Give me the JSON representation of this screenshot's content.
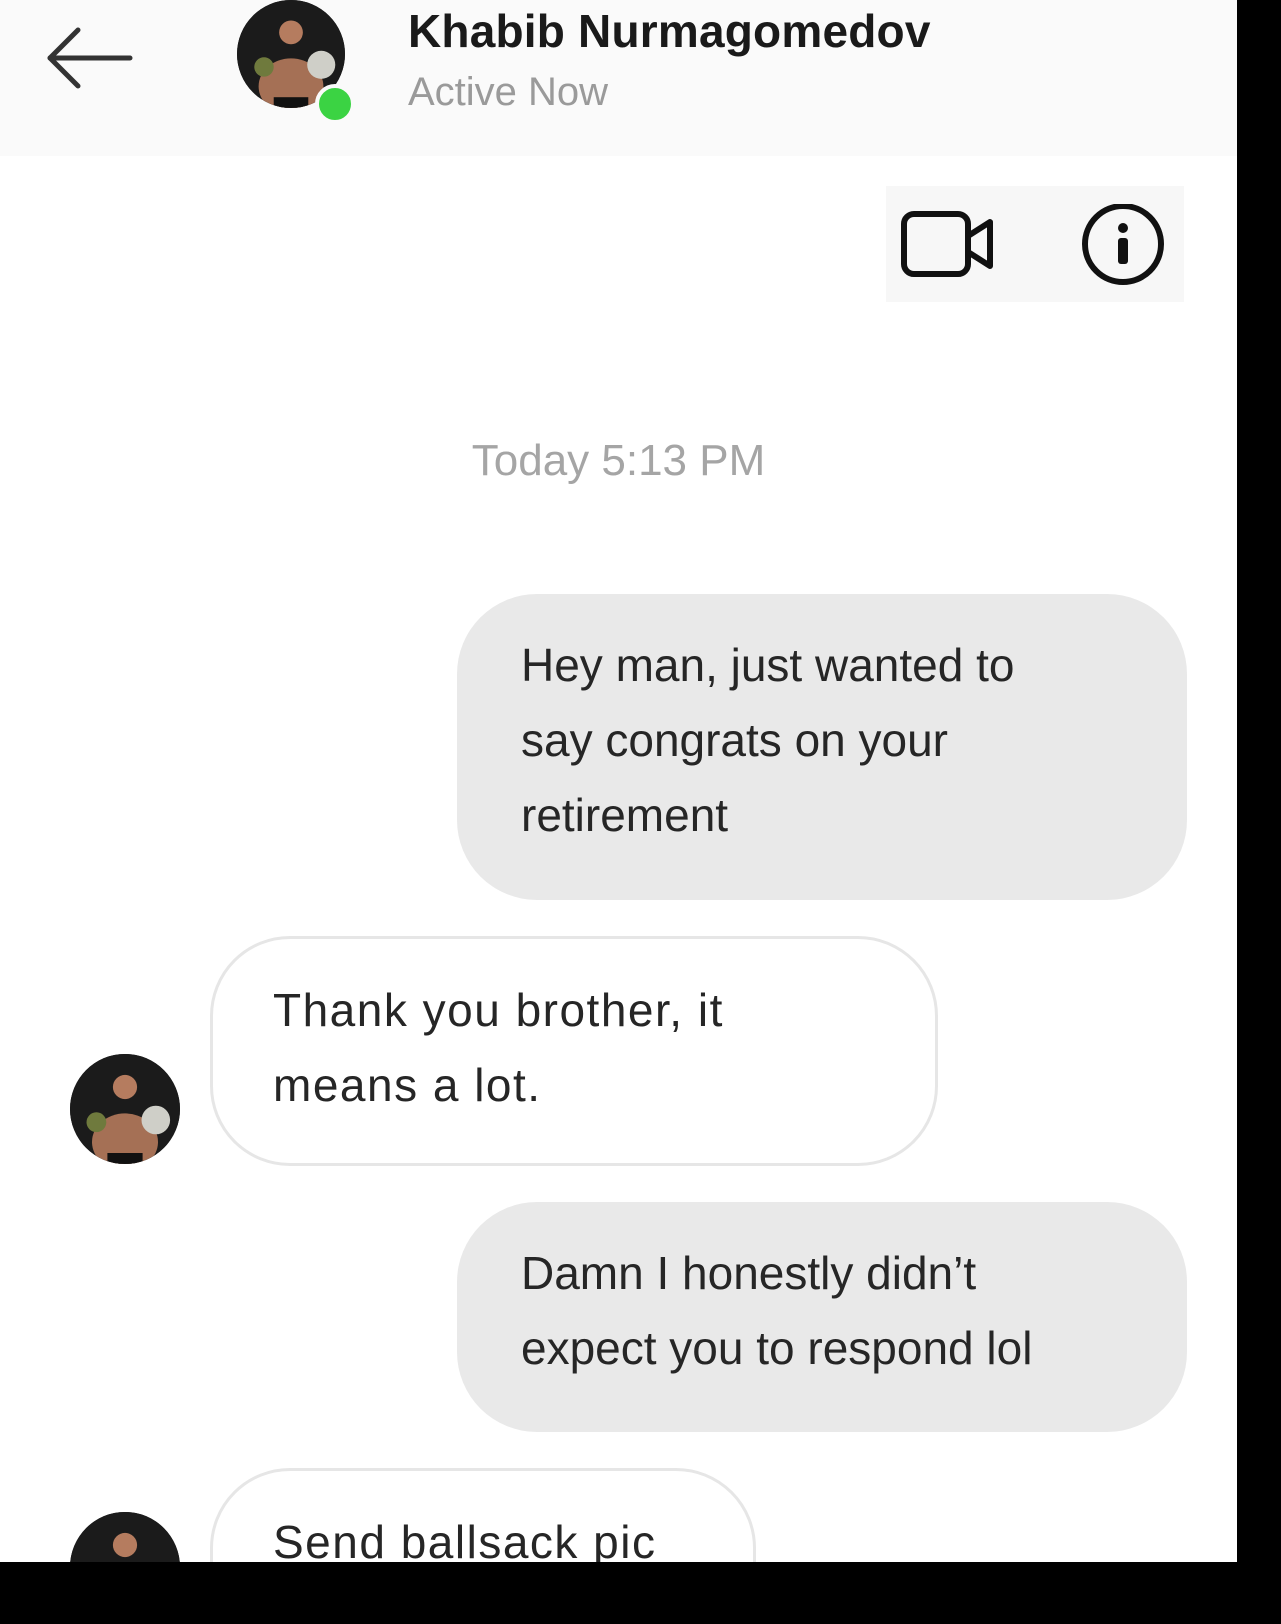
{
  "header": {
    "back_icon": "arrow-left-icon",
    "contact_name": "Khabib Nurmagomedov",
    "status": "Active Now",
    "online": true,
    "status_color": "#3bd343"
  },
  "actions": {
    "video_icon": "video-camera-icon",
    "info_icon": "info-icon"
  },
  "conversation": {
    "timestamp": "Today 5:13 PM",
    "messages": [
      {
        "direction": "outgoing",
        "text": "Hey man, just wanted to\nsay congrats on your\nretirement"
      },
      {
        "direction": "incoming",
        "text": "Thank you brother, it\nmeans a lot."
      },
      {
        "direction": "outgoing",
        "text": "Damn I honestly didn’t\nexpect you to respond lol"
      },
      {
        "direction": "incoming",
        "text": "Send ballsack pic"
      }
    ]
  },
  "colors": {
    "header_bg": "#fafafa",
    "outgoing_bubble": "#e9e9e9",
    "incoming_border": "#e6e6e6",
    "text": "#262626",
    "muted": "#a5a5a5"
  }
}
